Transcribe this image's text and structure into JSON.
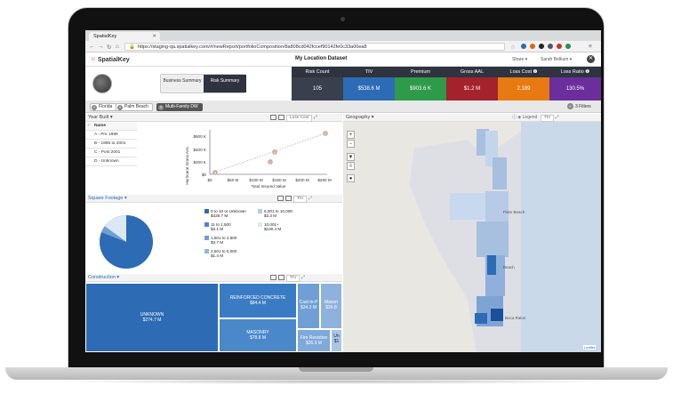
{
  "browser": {
    "tab_title": "SpatialKey",
    "url": "https://staging-qa.spatialkey.com/#/newReport/portfolioComposition/8a808cd042fccef90142fe0c33a00ea8"
  },
  "header": {
    "logo": "SpatialKey",
    "dataset_title": "My Location Dataset",
    "share": "Share ▾",
    "user": "Sarah Belkum ▾"
  },
  "summary_toggle": {
    "business": "Business Summary",
    "risk": "Risk Summary"
  },
  "metrics": [
    {
      "label": "Risk Count",
      "value": "105",
      "color": "#2f3340"
    },
    {
      "label": "TIV",
      "value": "$538.6 M",
      "color": "#2d6bb4"
    },
    {
      "label": "Premium",
      "value": "$903.6 K",
      "color": "#2f9a4a"
    },
    {
      "label": "Gross AAL",
      "value": "$1.2 M",
      "color": "#a3222b"
    },
    {
      "label": "Loss Cost ❶",
      "value": "2.189",
      "color": "#e87a12"
    },
    {
      "label": "Loss Ratio ❶",
      "value": "130.5%",
      "color": "#6a2f9c"
    }
  ],
  "filters": {
    "chips": [
      "Florida",
      "Palm Beach",
      "Multi-Family DW"
    ],
    "count": "3 Filters"
  },
  "year_built": {
    "title": "Year Built ▾",
    "measure": "Loss Cost",
    "table_header": "Name",
    "rows": [
      "A - Pre 1995",
      "B - 1995 to 2001",
      "C - Post 2001",
      "D - Unknown"
    ]
  },
  "scatter": {
    "ylabel": "Hurricane Gross AAL",
    "xlabel": "Total Insured Value",
    "yticks": [
      "$600 K",
      "$400 K",
      "$200 K",
      "$0"
    ],
    "xticks": [
      "$0",
      "$50 M",
      "$100 M",
      "$150 M",
      "$200 M",
      "$250 M"
    ],
    "point_labels": [
      "B",
      "A",
      "C",
      "D"
    ]
  },
  "square_footage": {
    "title": "Square Footage ▾",
    "measure": "TIV",
    "legend": [
      {
        "label": "0 to 10 or Unknown",
        "value": "$426.7 M",
        "color": "#2d6bb4"
      },
      {
        "label": "11 to 1,500",
        "value": "$3.1 M",
        "color": "#4b86c8"
      },
      {
        "label": "1,501 to 2,500",
        "value": "$3.7 M",
        "color": "#6f9fd4"
      },
      {
        "label": "2,501 to 5,000",
        "value": "$1.4 M",
        "color": "#93b7e0"
      },
      {
        "label": "5,001 to 10,000",
        "value": "$3.3 M",
        "color": "#b5cdea"
      },
      {
        "label": "10,001+",
        "value": "$100.4 M",
        "color": "#dde8f5"
      }
    ]
  },
  "construction": {
    "title": "Construction ▾",
    "measure": "TIV",
    "cells": [
      {
        "label": "UNKNOWN",
        "value": "$274.7 M"
      },
      {
        "label": "REINFORCED CONCRETE",
        "value": "$84.4 M"
      },
      {
        "label": "MASONRY",
        "value": "$78.8 M"
      },
      {
        "label": "Cast-in-P",
        "value": "$34.2 M"
      },
      {
        "label": "Mason",
        "value": "$26.8"
      },
      {
        "label": "Fire Resistive",
        "value": "$26.3 M"
      },
      {
        "label": "Un",
        "value": "$1"
      }
    ]
  },
  "geography": {
    "title": "Geography ▾",
    "legend": "Legend",
    "measure": "TIV",
    "labels": [
      "Palm Beach",
      "Beach",
      "Boca Raton"
    ],
    "attribution": "Leaflet"
  }
}
